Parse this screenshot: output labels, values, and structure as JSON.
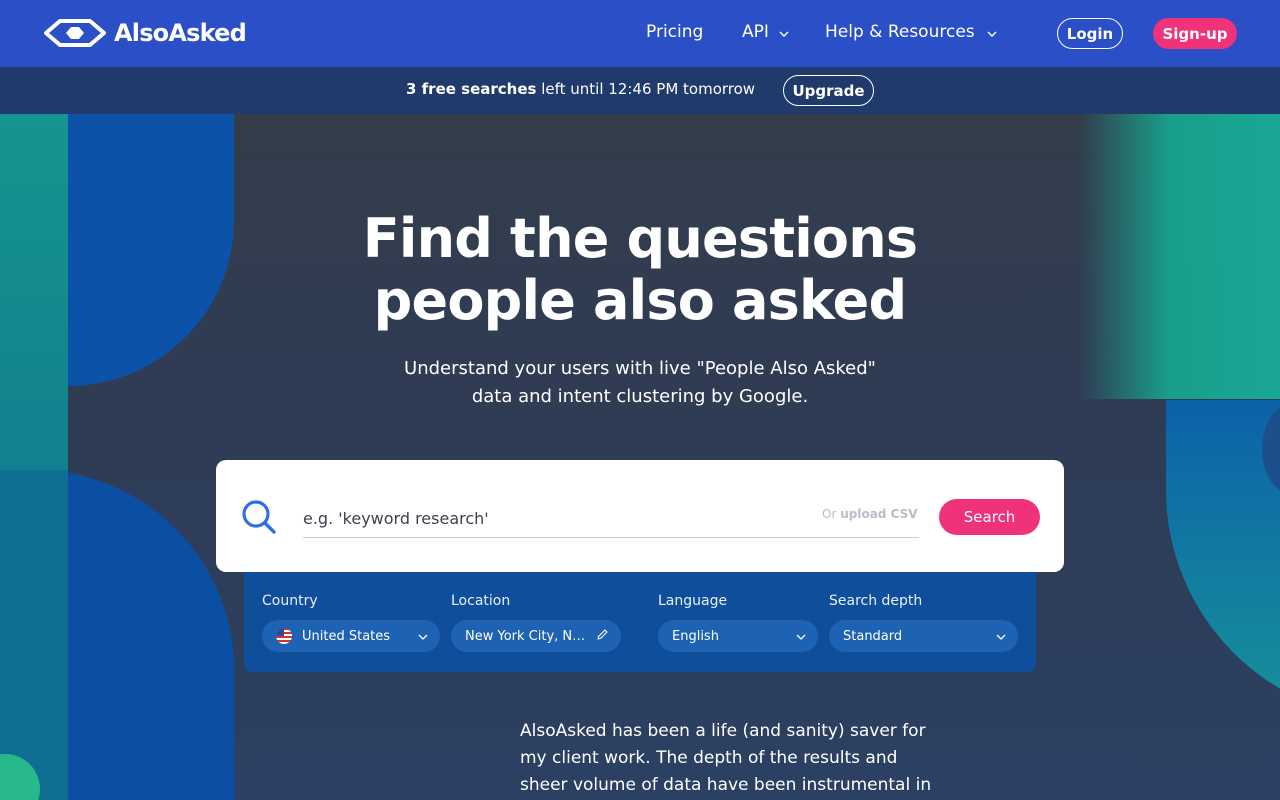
{
  "header": {
    "brand": "AlsoAsked",
    "nav": [
      {
        "label": "Pricing"
      },
      {
        "label": "API"
      },
      {
        "label": "Help & Resources"
      }
    ],
    "login_label": "Login",
    "signup_label": "Sign-up"
  },
  "banner": {
    "count_text": "3 free searches",
    "rest_text": " left until 12:46 PM tomorrow",
    "upgrade_label": "Upgrade"
  },
  "hero": {
    "title_line1": "Find the questions",
    "title_line2": "people also asked",
    "subtitle_line1": "Understand your users with live \"People Also Asked\"",
    "subtitle_line2": "data and intent clustering by Google."
  },
  "search": {
    "placeholder": "e.g. 'keyword research'",
    "value": "",
    "or_text": "Or",
    "upload_label": "upload CSV",
    "button_label": "Search"
  },
  "options": {
    "country": {
      "label": "Country",
      "value": "United States"
    },
    "location": {
      "label": "Location",
      "value": "New York City, Ne..."
    },
    "language": {
      "label": "Language",
      "value": "English"
    },
    "depth": {
      "label": "Search depth",
      "value": "Standard"
    }
  },
  "testimonial": {
    "text": "AlsoAsked has been a life (and sanity) saver for my client work. The depth of the results and sheer volume of data have been instrumental in numerous"
  },
  "colors": {
    "header_bg": "#2b4fc6",
    "accent_pink": "#f0327b",
    "panel_blue": "#0f4e9b",
    "banner_bg": "#1f3a6b"
  },
  "icons": {
    "logo": "logo-icon",
    "search": "search-icon",
    "chevron": "chevron-down-icon",
    "pencil": "pencil-icon",
    "flag": "us-flag-icon"
  }
}
